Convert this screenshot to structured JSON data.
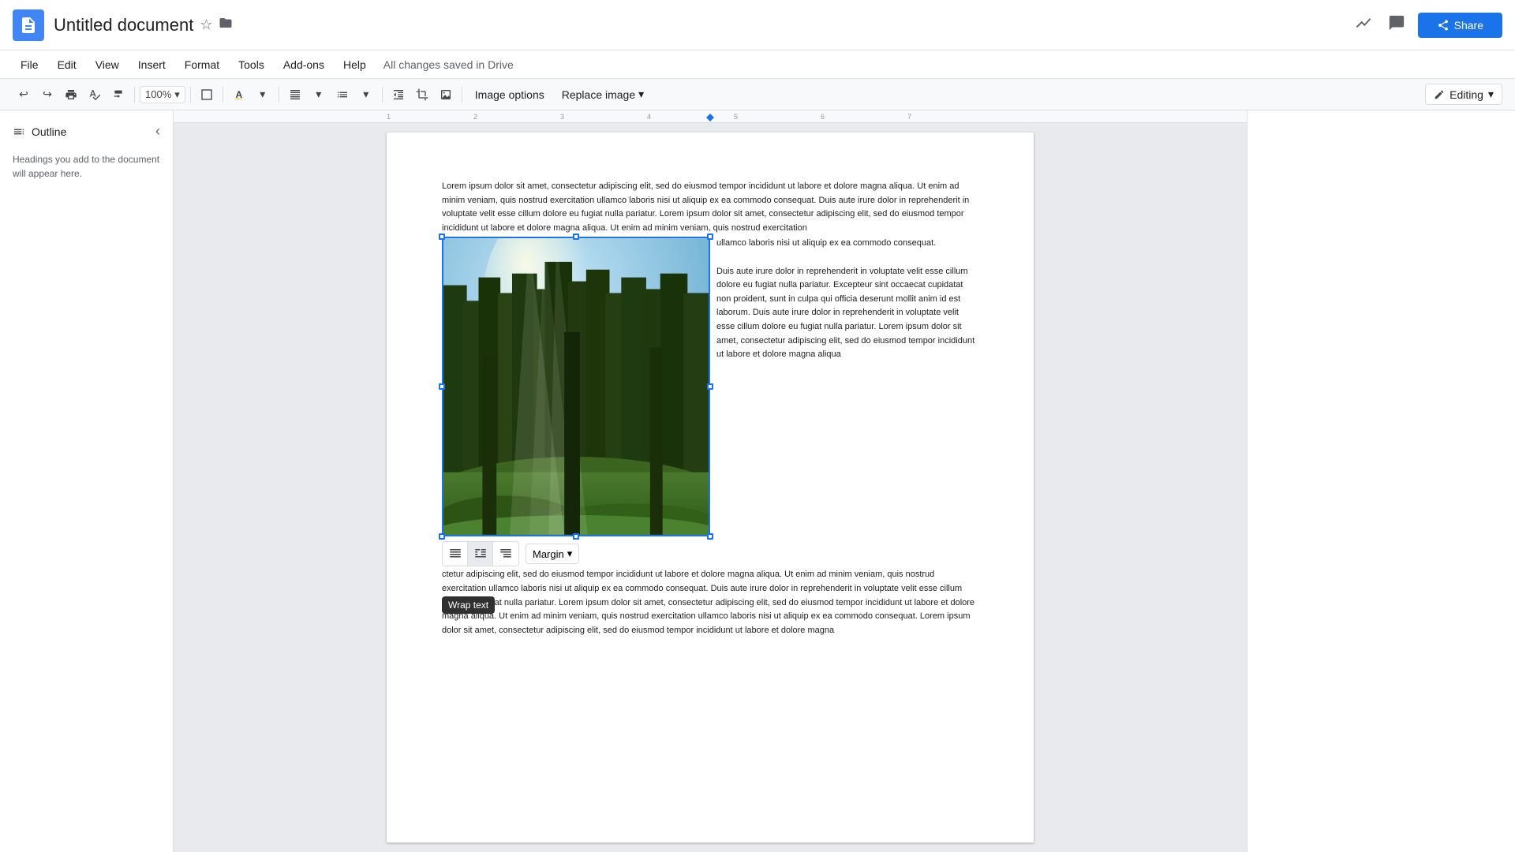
{
  "app": {
    "icon_label": "Google Docs",
    "doc_title": "Untitled document",
    "saved_status": "All changes saved in Drive"
  },
  "title_bar": {
    "star_icon": "☆",
    "folder_icon": "📁",
    "share_label": "Share",
    "stats_icon": "📈",
    "comment_icon": "💬"
  },
  "menu": {
    "file": "File",
    "edit": "Edit",
    "view": "View",
    "insert": "Insert",
    "format": "Format",
    "tools": "Tools",
    "addons": "Add-ons",
    "help": "Help"
  },
  "toolbar": {
    "zoom": "100%",
    "image_options": "Image options",
    "replace_image": "Replace image",
    "editing": "Editing",
    "chevron": "▾"
  },
  "sidebar": {
    "title": "Outline",
    "hint": "Headings you add to the document will appear here."
  },
  "image_toolbar": {
    "margin_label": "Margin",
    "wrap_tooltip": "Wrap text"
  },
  "document": {
    "para1": "Lorem ipsum dolor sit amet, consectetur adipiscing elit, sed do eiusmod tempor incididunt ut labore et dolore magna aliqua. Ut enim ad minim veniam, quis nostrud exercitation ullamco laboris nisi ut aliquip ex ea commodo consequat. Duis aute irure dolor in reprehenderit in voluptate velit esse cillum dolore eu fugiat nulla pariatur. Lorem ipsum dolor sit amet, consectetur adipiscing elit, sed do eiusmod tempor incididunt ut labore et dolore magna aliqua. Ut enim ad minim veniam, quis nostrud exercitation",
    "right_text1": "ullamco laboris nisi ut aliquip ex ea commodo consequat.\n\nDuis aute irure dolor in reprehenderit in voluptate velit esse cillum dolore eu fugiat nulla pariatur. Excepteur sint occaecat cupidatat non proident, sunt in culpa qui officia deserunt mollit anim id est laborum. Duis aute irure dolor in reprehenderit in voluptate velit esse cillum dolore eu fugiat nulla pariatur. Lorem ipsum dolor sit amet, consectetur adipiscing elit, sed do eiusmod tempor incididunt ut labore et dolore magna aliqua",
    "para_after": "ctetur adipiscing elit, sed do eiusmod tempor incididunt ut labore et dolore magna aliqua. Ut enim ad minim veniam, quis nostrud exercitation ullamco laboris nisi ut aliquip ex ea commodo consequat. Duis aute irure dolor in reprehenderit in voluptate velit esse cillum dolore eu fugiat nulla pariatur. Lorem ipsum dolor sit amet, consectetur adipiscing elit, sed do eiusmod tempor incididunt ut labore et dolore magna aliqua. Ut enim ad minim veniam, quis nostrud exercitation ullamco laboris nisi ut aliquip ex ea commodo consequat. Lorem ipsum dolor sit amet, consectetur adipiscing elit, sed do eiusmod tempor incididunt ut labore et dolore magna"
  },
  "colors": {
    "google_blue": "#1a73e8",
    "handle_color": "#1a73e8",
    "text_dark": "#202124",
    "text_muted": "#5f6368"
  }
}
